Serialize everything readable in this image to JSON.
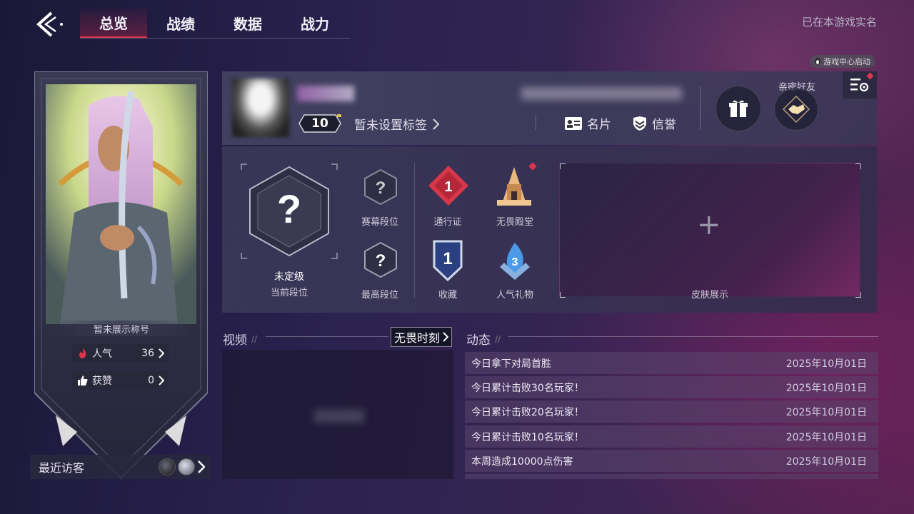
{
  "nav": {
    "tabs": [
      "总览",
      "战绩",
      "数据",
      "战力"
    ],
    "active_tab": 0,
    "realname_status": "已在本游戏实名",
    "launch_badge": "游戏中心启动"
  },
  "hero_card": {
    "title_plate": "暂未展示称号",
    "popularity_label": "人气",
    "popularity_value": "36",
    "likes_label": "获赞",
    "likes_value": "0",
    "recent_visitors_label": "最近访客"
  },
  "profile": {
    "level": "10",
    "tag_placeholder": "暂未设置标签",
    "card_label": "名片",
    "credit_label": "信誉",
    "intimate_friends_label": "亲密好友"
  },
  "rank": {
    "current_rank_value": "未定级",
    "current_rank_label": "当前段位",
    "season_rank_label": "赛幕段位",
    "highest_rank_label": "最高段位",
    "pass_label": "通行证",
    "pass_level": "1",
    "hall_label": "无畏殿堂",
    "collection_label": "收藏",
    "collection_level": "1",
    "gift_label": "人气礼物",
    "gift_level": "3",
    "skin_label": "皮肤展示"
  },
  "videos": {
    "title": "视频",
    "button_label": "无畏时刻"
  },
  "feed": {
    "title": "动态",
    "items": [
      {
        "text": "今日拿下对局首胜",
        "date": "2025年10月01日"
      },
      {
        "text": "今日累计击败30名玩家！",
        "date": "2025年10月01日"
      },
      {
        "text": "今日累计击败20名玩家！",
        "date": "2025年10月01日"
      },
      {
        "text": "今日累计击败10名玩家！",
        "date": "2025年10月01日"
      },
      {
        "text": "本周造成10000点伤害",
        "date": "2025年10月01日"
      }
    ]
  },
  "colors": {
    "accent_red": "#e0344f",
    "background_deep": "#1a1838",
    "panel": "#3c3a5a"
  }
}
